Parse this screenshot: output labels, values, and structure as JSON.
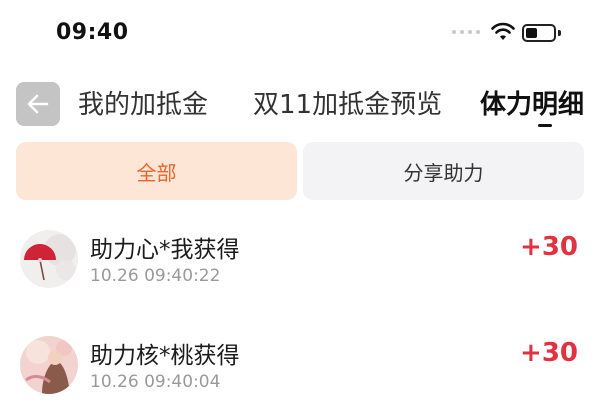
{
  "status_bar": {
    "time": "09:40"
  },
  "nav": {
    "tabs": [
      {
        "label": "我的加抵金",
        "active": false
      },
      {
        "label": "双11加抵金预览",
        "active": false
      },
      {
        "label": "体力明细",
        "active": true
      }
    ]
  },
  "filters": [
    {
      "label": "全部",
      "selected": true
    },
    {
      "label": "分享助力",
      "selected": false
    }
  ],
  "records": [
    {
      "title": "助力心*我获得",
      "time": "10.26 09:40:22",
      "points": "+30"
    },
    {
      "title": "助力核*桃获得",
      "time": "10.26 09:40:04",
      "points": "+30"
    }
  ],
  "colors": {
    "accent": "#e8652b",
    "accent_bg": "#fde6d6",
    "points": "#e2313f"
  }
}
